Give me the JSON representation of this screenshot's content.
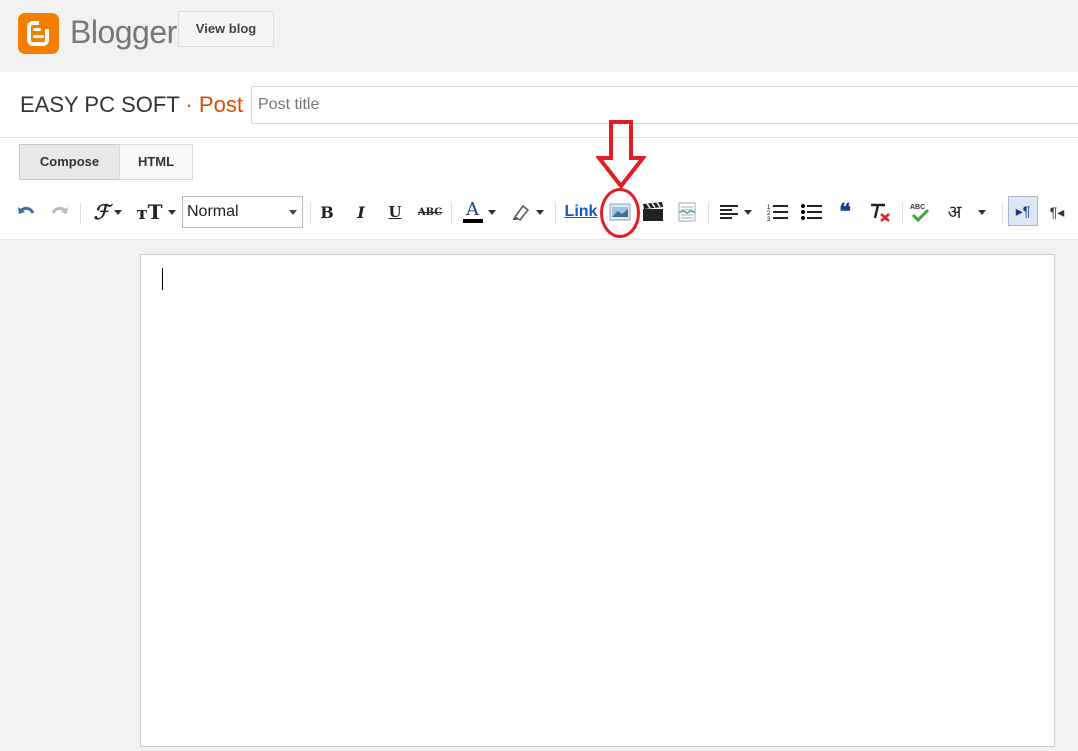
{
  "header": {
    "logo_text": "Blogger",
    "view_blog_label": "View blog"
  },
  "post": {
    "blog_name": "EASY PC SOFT",
    "separator": " · ",
    "post_label": "Post",
    "title_placeholder": "Post title",
    "title_value": ""
  },
  "modes": {
    "compose_label": "Compose",
    "html_label": "HTML",
    "active": "Compose"
  },
  "toolbar": {
    "format_value": "Normal",
    "link_label": "Link",
    "tools": [
      "undo-icon",
      "redo-icon",
      "font-family-icon",
      "font-size-icon",
      "format-select",
      "bold-icon",
      "italic-icon",
      "underline-icon",
      "strikethrough-icon",
      "text-color-icon",
      "highlight-icon",
      "link",
      "insert-image-icon",
      "insert-video-icon",
      "insert-jump-break-icon",
      "align-icon",
      "numbered-list-icon",
      "bulleted-list-icon",
      "quote-icon",
      "remove-formatting-icon",
      "spell-check-icon",
      "input-tools-icon",
      "ltr-icon",
      "rtl-icon"
    ],
    "bold_glyph": "B",
    "italic_glyph": "I",
    "underline_glyph": "U",
    "strike_glyph": "ABC",
    "textcolor_glyph": "A",
    "hindi_glyph": "अ",
    "quote_glyph": "❝",
    "accent_color": "#f57d00",
    "annotation_color": "#e41c24"
  },
  "editor": {
    "content": ""
  }
}
